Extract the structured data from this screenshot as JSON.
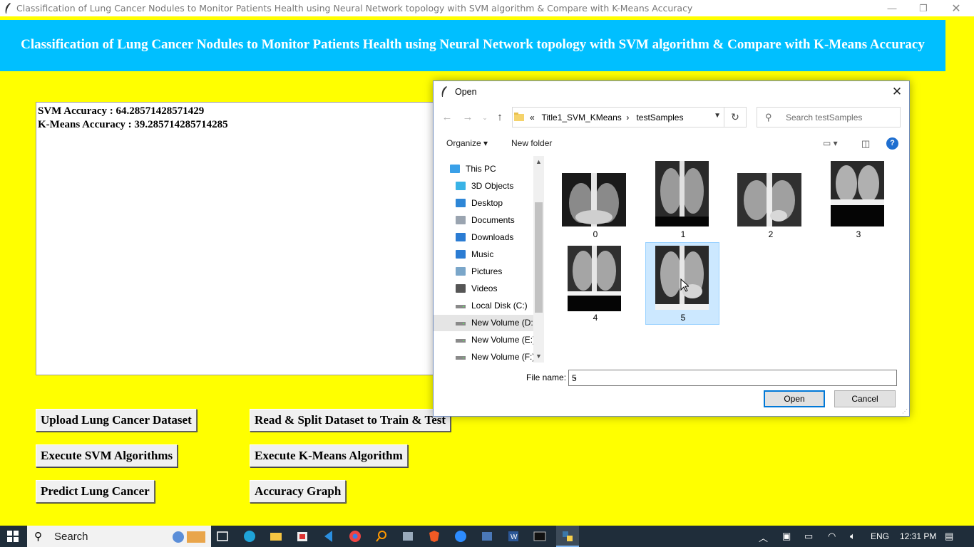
{
  "window": {
    "title": "Classification of Lung Cancer Nodules to Monitor Patients Health using Neural Network topology with SVM algorithm & Compare with K-Means Accuracy"
  },
  "header": {
    "title": "Classification of Lung Cancer Nodules to Monitor Patients Health using Neural Network topology with SVM algorithm & Compare with K-Means Accuracy"
  },
  "output": {
    "lines": [
      "SVM Accuracy : 64.28571428571429",
      "K-Means Accuracy : 39.285714285714285"
    ]
  },
  "buttons": {
    "upload": "Upload Lung Cancer Dataset",
    "read_split": "Read & Split Dataset to Train & Test",
    "svm": "Execute SVM Algorithms",
    "kmeans": "Execute K-Means Algorithm",
    "predict": "Predict Lung Cancer",
    "graph": "Accuracy Graph"
  },
  "dialog": {
    "title": "Open",
    "breadcrumb_prefix": "«",
    "breadcrumb": [
      "Title1_SVM_KMeans",
      "testSamples"
    ],
    "search_placeholder": "Search testSamples",
    "toolbar": {
      "organize": "Organize ▾",
      "new_folder": "New folder"
    },
    "nav_items": [
      {
        "label": "This PC",
        "icon": "pc-icon"
      },
      {
        "label": "3D Objects",
        "icon": "3d-objects-icon"
      },
      {
        "label": "Desktop",
        "icon": "desktop-icon"
      },
      {
        "label": "Documents",
        "icon": "documents-icon"
      },
      {
        "label": "Downloads",
        "icon": "downloads-icon"
      },
      {
        "label": "Music",
        "icon": "music-icon"
      },
      {
        "label": "Pictures",
        "icon": "pictures-icon"
      },
      {
        "label": "Videos",
        "icon": "videos-icon"
      },
      {
        "label": "Local Disk (C:)",
        "icon": "drive-icon"
      },
      {
        "label": "New Volume (D:",
        "icon": "drive-icon"
      },
      {
        "label": "New Volume (E:)",
        "icon": "drive-icon"
      },
      {
        "label": "New Volume (F:)",
        "icon": "drive-icon"
      }
    ],
    "files": [
      "0",
      "1",
      "2",
      "3",
      "4",
      "5"
    ],
    "selected_file": "5",
    "file_name_label": "File name:",
    "file_name_value": "5",
    "open_button": "Open",
    "cancel_button": "Cancel"
  },
  "taskbar": {
    "search_text": "Search",
    "language": "ENG",
    "time": "12:31 PM"
  },
  "colors": {
    "app_background": "#ffff00",
    "header_background": "#00bfff",
    "selection": "#cce8ff"
  }
}
